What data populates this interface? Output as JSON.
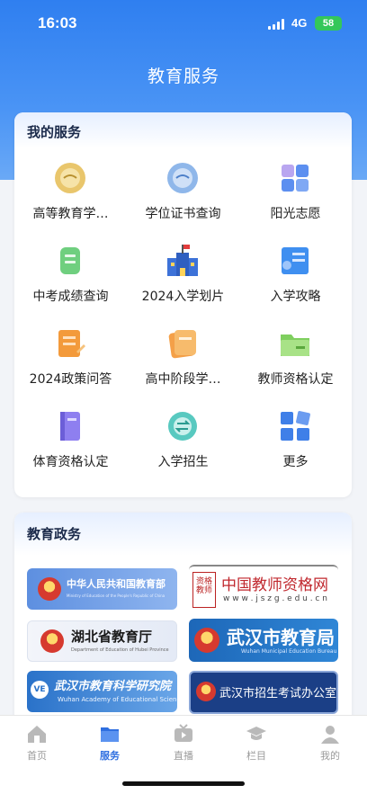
{
  "status": {
    "time": "16:03",
    "network": "4G",
    "battery": "58"
  },
  "header": {
    "title": "教育服务"
  },
  "services": {
    "title": "我的服务",
    "items": [
      {
        "label": "高等教育学…",
        "icon": "higher-education-icon"
      },
      {
        "label": "学位证书查询",
        "icon": "degree-certificate-icon"
      },
      {
        "label": "阳光志愿",
        "icon": "sunshine-volunteer-icon"
      },
      {
        "label": "中考成绩查询",
        "icon": "exam-score-icon"
      },
      {
        "label": "2024入学划片",
        "icon": "school-district-icon"
      },
      {
        "label": "入学攻略",
        "icon": "admission-guide-icon"
      },
      {
        "label": "2024政策问答",
        "icon": "policy-qa-icon"
      },
      {
        "label": "高中阶段学…",
        "icon": "high-school-icon"
      },
      {
        "label": "教师资格认定",
        "icon": "teacher-qualification-icon"
      },
      {
        "label": "体育资格认定",
        "icon": "sports-qualification-icon"
      },
      {
        "label": "入学招生",
        "icon": "enrollment-icon"
      },
      {
        "label": "更多",
        "icon": "more-grid-icon"
      }
    ]
  },
  "gov": {
    "title": "教育政务",
    "banners": {
      "moe": {
        "cn": "中华人民共和国教育部",
        "en": "Ministry of Education of the People's Republic of China"
      },
      "teacher": {
        "side": "资格",
        "side2": "教师",
        "cn": "中国教师资格网",
        "url": "w w w . j s z g . e d u . c n"
      },
      "hubei": {
        "cn": "湖北省教育厅",
        "en": "Department of Education of Hubei Province"
      },
      "wuhan": {
        "cn": "武汉市教育局",
        "en": "Wuhan Municipal Education Bureau"
      },
      "academy": {
        "logo": "VE",
        "cn": "武汉市教育科学研究院",
        "en": "Wuhan Academy of Educational Science"
      },
      "exam": {
        "cn": "武汉市招生考试办公室"
      }
    }
  },
  "tabs": [
    {
      "label": "首页",
      "icon": "home-icon",
      "active": false
    },
    {
      "label": "服务",
      "icon": "service-folder-icon",
      "active": true
    },
    {
      "label": "直播",
      "icon": "live-tv-icon",
      "active": false
    },
    {
      "label": "栏目",
      "icon": "graduation-cap-icon",
      "active": false
    },
    {
      "label": "我的",
      "icon": "profile-icon",
      "active": false
    }
  ],
  "colors": {
    "primary": "#2f6fe0",
    "hero": "#3a88f2"
  }
}
